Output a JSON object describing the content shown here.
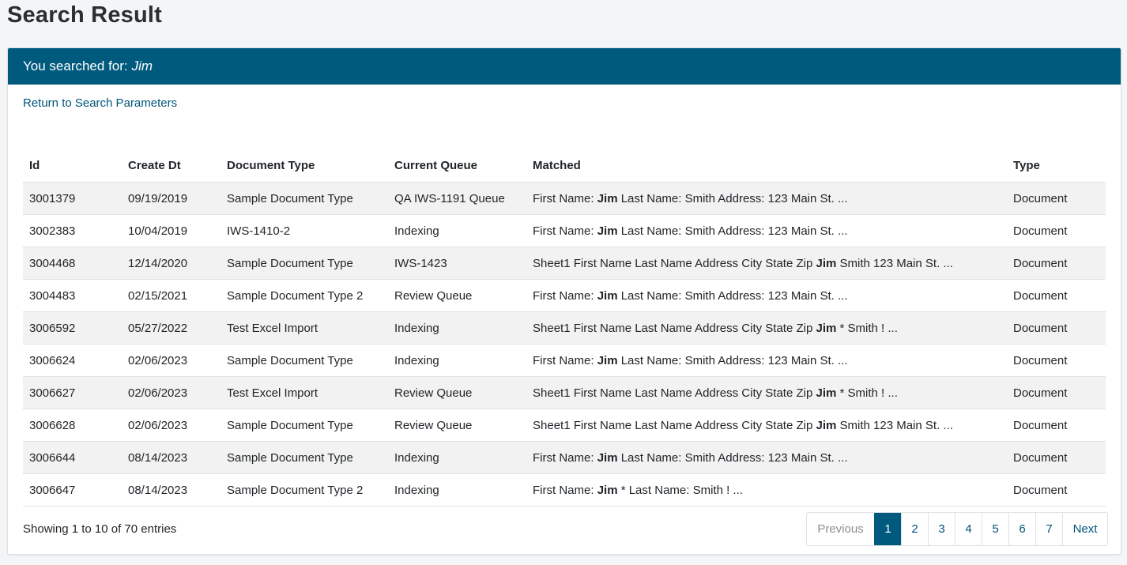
{
  "page_title": "Search Result",
  "header": {
    "prefix": "You searched for:",
    "query": "Jim"
  },
  "return_link": "Return to Search Parameters",
  "table": {
    "columns": [
      "Id",
      "Create Dt",
      "Document Type",
      "Current Queue",
      "Matched",
      "Type"
    ],
    "rows": [
      {
        "id": "3001379",
        "create_dt": "09/19/2019",
        "document_type": "Sample Document Type",
        "queue": "QA IWS-1191 Queue",
        "matched_before": "First Name: ",
        "matched_highlight": "Jim",
        "matched_after": " Last Name: Smith Address: 123 Main St. ...",
        "type": "Document"
      },
      {
        "id": "3002383",
        "create_dt": "10/04/2019",
        "document_type": "IWS-1410-2",
        "queue": "Indexing",
        "matched_before": "First Name: ",
        "matched_highlight": "Jim",
        "matched_after": " Last Name: Smith Address: 123 Main St. ...",
        "type": "Document"
      },
      {
        "id": "3004468",
        "create_dt": "12/14/2020",
        "document_type": "Sample Document Type",
        "queue": "IWS-1423",
        "matched_before": "Sheet1 First Name Last Name Address City State Zip ",
        "matched_highlight": "Jim",
        "matched_after": " Smith 123 Main St. ...",
        "type": "Document"
      },
      {
        "id": "3004483",
        "create_dt": "02/15/2021",
        "document_type": "Sample Document Type 2",
        "queue": "Review Queue",
        "matched_before": "First Name: ",
        "matched_highlight": "Jim",
        "matched_after": " Last Name: Smith Address: 123 Main St. ...",
        "type": "Document"
      },
      {
        "id": "3006592",
        "create_dt": "05/27/2022",
        "document_type": "Test Excel Import",
        "queue": "Indexing",
        "matched_before": "Sheet1 First Name Last Name Address City State Zip ",
        "matched_highlight": "Jim",
        "matched_after": " * Smith ! ...",
        "type": "Document"
      },
      {
        "id": "3006624",
        "create_dt": "02/06/2023",
        "document_type": "Sample Document Type",
        "queue": "Indexing",
        "matched_before": "First Name: ",
        "matched_highlight": "Jim",
        "matched_after": " Last Name: Smith Address: 123 Main St. ...",
        "type": "Document"
      },
      {
        "id": "3006627",
        "create_dt": "02/06/2023",
        "document_type": "Test Excel Import",
        "queue": "Review Queue",
        "matched_before": "Sheet1 First Name Last Name Address City State Zip ",
        "matched_highlight": "Jim",
        "matched_after": " * Smith ! ...",
        "type": "Document"
      },
      {
        "id": "3006628",
        "create_dt": "02/06/2023",
        "document_type": "Sample Document Type",
        "queue": "Review Queue",
        "matched_before": "Sheet1 First Name Last Name Address City State Zip ",
        "matched_highlight": "Jim",
        "matched_after": " Smith 123 Main St. ...",
        "type": "Document"
      },
      {
        "id": "3006644",
        "create_dt": "08/14/2023",
        "document_type": "Sample Document Type",
        "queue": "Indexing",
        "matched_before": "First Name: ",
        "matched_highlight": "Jim",
        "matched_after": " Last Name: Smith Address: 123 Main St. ...",
        "type": "Document"
      },
      {
        "id": "3006647",
        "create_dt": "08/14/2023",
        "document_type": "Sample Document Type 2",
        "queue": "Indexing",
        "matched_before": "First Name: ",
        "matched_highlight": "Jim",
        "matched_after": " * Last Name: Smith ! ...",
        "type": "Document"
      }
    ]
  },
  "footer": {
    "info": "Showing 1 to 10 of 70 entries",
    "pagination": {
      "previous": "Previous",
      "pages": [
        "1",
        "2",
        "3",
        "4",
        "5",
        "6",
        "7"
      ],
      "active_page": "1",
      "next": "Next"
    }
  },
  "colors": {
    "header_bg": "#005a7d",
    "link": "#00557a",
    "stripe": "#f2f2f2"
  }
}
